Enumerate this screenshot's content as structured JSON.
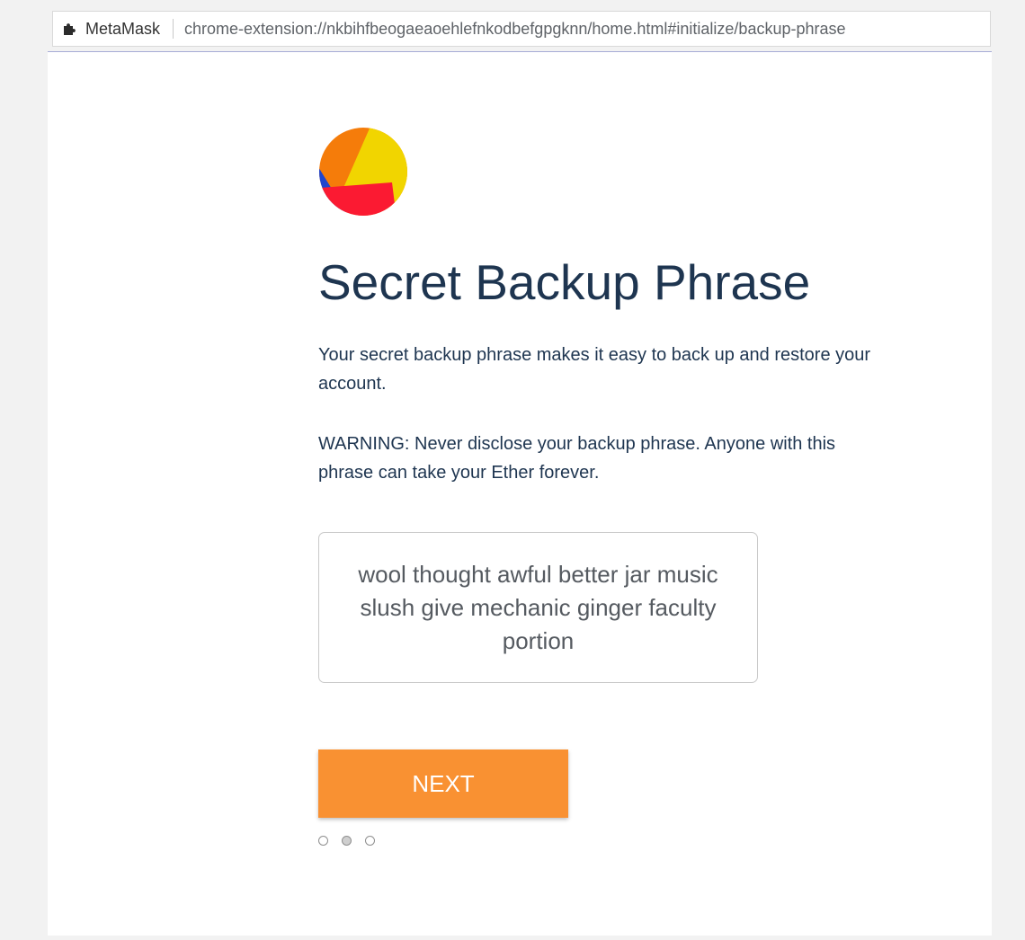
{
  "browser": {
    "extension_name": "MetaMask",
    "url": "chrome-extension://nkbihfbeogaeaoehlefnkodbefgpgknn/home.html#initialize/backup-phrase",
    "extension_icon": "puzzle-piece-icon"
  },
  "page": {
    "logo": "metamask-identicon",
    "title": "Secret Backup Phrase",
    "description": "Your secret backup phrase makes it easy to back up and restore your account.",
    "warning": "WARNING: Never disclose your backup phrase. Anyone with this phrase can take your Ether forever.",
    "seed_phrase": "wool thought awful better jar music slush give mechanic ginger faculty portion",
    "next_label": "NEXT"
  },
  "pagination": {
    "total": 3,
    "active": 2
  },
  "colors": {
    "accent": "#f99132",
    "title": "#1e3550",
    "logo_orange": "#f57c0a",
    "logo_yellow": "#f1d500",
    "logo_red": "#fb1a32",
    "logo_blue": "#2045ce"
  }
}
